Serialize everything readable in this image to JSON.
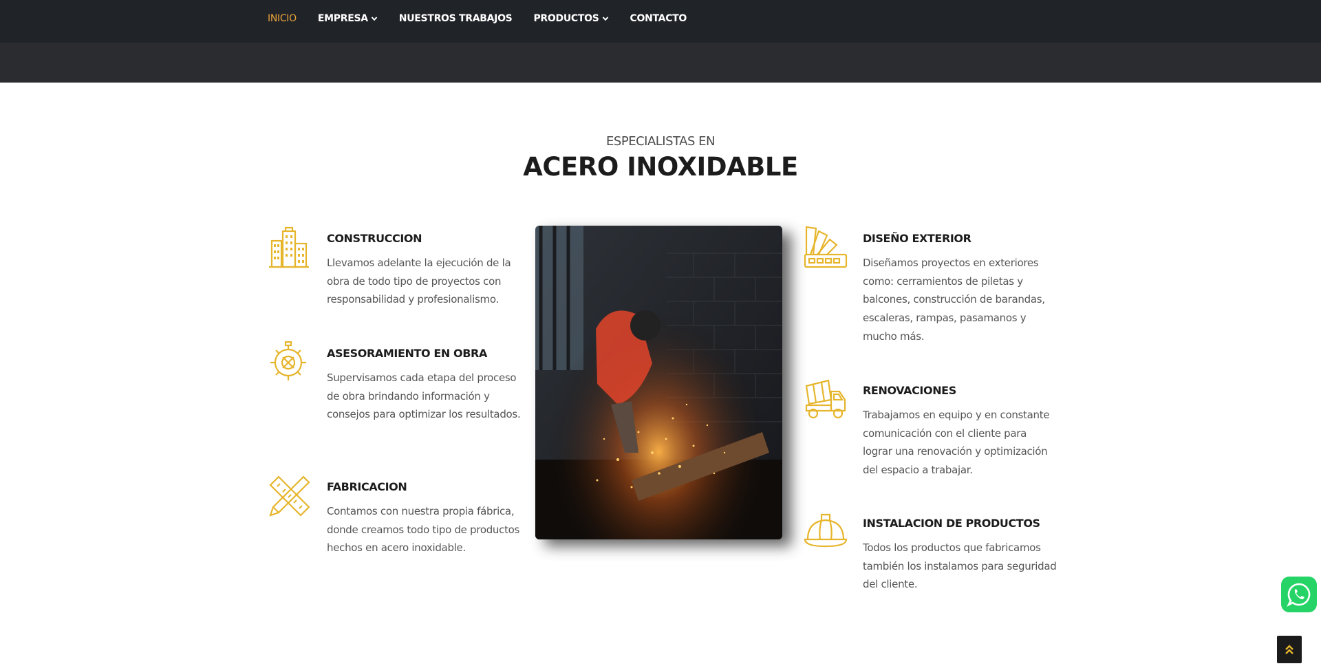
{
  "nav": {
    "items": [
      {
        "label": "INICIO",
        "active": true
      },
      {
        "label": "EMPRESA",
        "dropdown": true
      },
      {
        "label": "NUESTROS TRABAJOS"
      },
      {
        "label": "PRODUCTOS",
        "dropdown": true
      },
      {
        "label": "CONTACTO"
      }
    ]
  },
  "hero": {
    "kicker": "ESPECIALISTAS EN",
    "title": "ACERO INOXIDABLE"
  },
  "features": {
    "construccion": {
      "title": "CONSTRUCCION",
      "text": "Llevamos adelante la ejecución de la obra de todo tipo de proyectos con responsabilidad y profesionalismo.",
      "icon": "buildings-icon"
    },
    "asesoramiento": {
      "title": "ASESORAMIENTO EN OBRA",
      "text": "Supervisamos cada etapa del proceso de obra brindando información y consejos para optimizar los resultados.",
      "icon": "gear-tools-icon"
    },
    "fabricacion": {
      "title": "FABRICACION",
      "text": "Contamos con nuestra propia fábrica, donde creamos todo tipo de productos hechos en acero inoxidable.",
      "icon": "pencil-ruler-icon"
    },
    "diseno": {
      "title": "DISEÑO EXTERIOR",
      "text": "Diseñamos proyectos en exteriores como: cerramientos de piletas y balcones, construcción de barandas, escaleras, rampas, pasamanos y mucho más.",
      "icon": "color-swatch-icon"
    },
    "renovaciones": {
      "title": "RENOVACIONES",
      "text": "Trabajamos en equipo y en constante comunicación con el cliente para lograr una renovación y optimización del espacio a trabajar.",
      "icon": "cement-truck-icon"
    },
    "instalacion": {
      "title": "INSTALACION DE PRODUCTOS",
      "text": "Todos los productos que fabricamos también los instalamos para seguridad del cliente.",
      "icon": "hard-hat-icon"
    }
  },
  "colors": {
    "accent": "#e8a33b",
    "icon_gold": "#e6b52c",
    "nav_bg": "#202328",
    "whatsapp": "#25d366"
  }
}
